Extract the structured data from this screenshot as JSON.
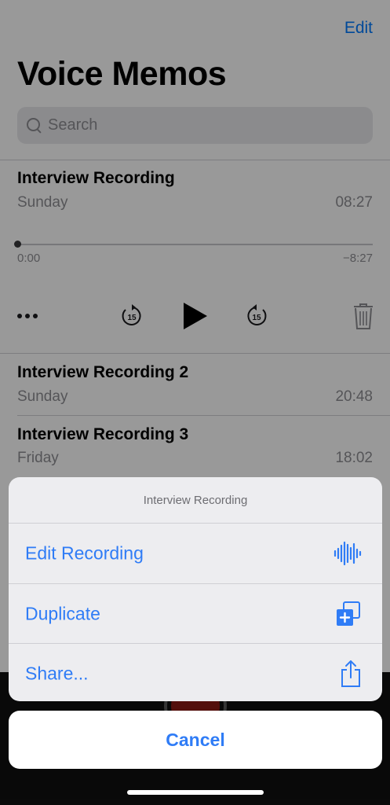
{
  "header": {
    "edit_label": "Edit",
    "title": "Voice Memos"
  },
  "search": {
    "placeholder": "Search"
  },
  "recordings": [
    {
      "name": "Interview Recording",
      "date": "Sunday",
      "duration": "08:27",
      "expanded": true
    },
    {
      "name": "Interview Recording 2",
      "date": "Sunday",
      "duration": "20:48"
    },
    {
      "name": "Interview Recording 3",
      "date": "Friday",
      "duration": "18:02"
    }
  ],
  "player": {
    "elapsed": "0:00",
    "remaining": "−8:27",
    "skip_back_label": "15",
    "skip_forward_label": "15",
    "progress": 0
  },
  "action_sheet": {
    "title": "Interview Recording",
    "items": [
      {
        "label": "Edit Recording",
        "icon": "waveform-icon"
      },
      {
        "label": "Duplicate",
        "icon": "duplicate-icon"
      },
      {
        "label": "Share...",
        "icon": "share-icon"
      }
    ],
    "cancel_label": "Cancel"
  },
  "colors": {
    "accent": "#2f7cf6",
    "record": "#8b1a14"
  }
}
